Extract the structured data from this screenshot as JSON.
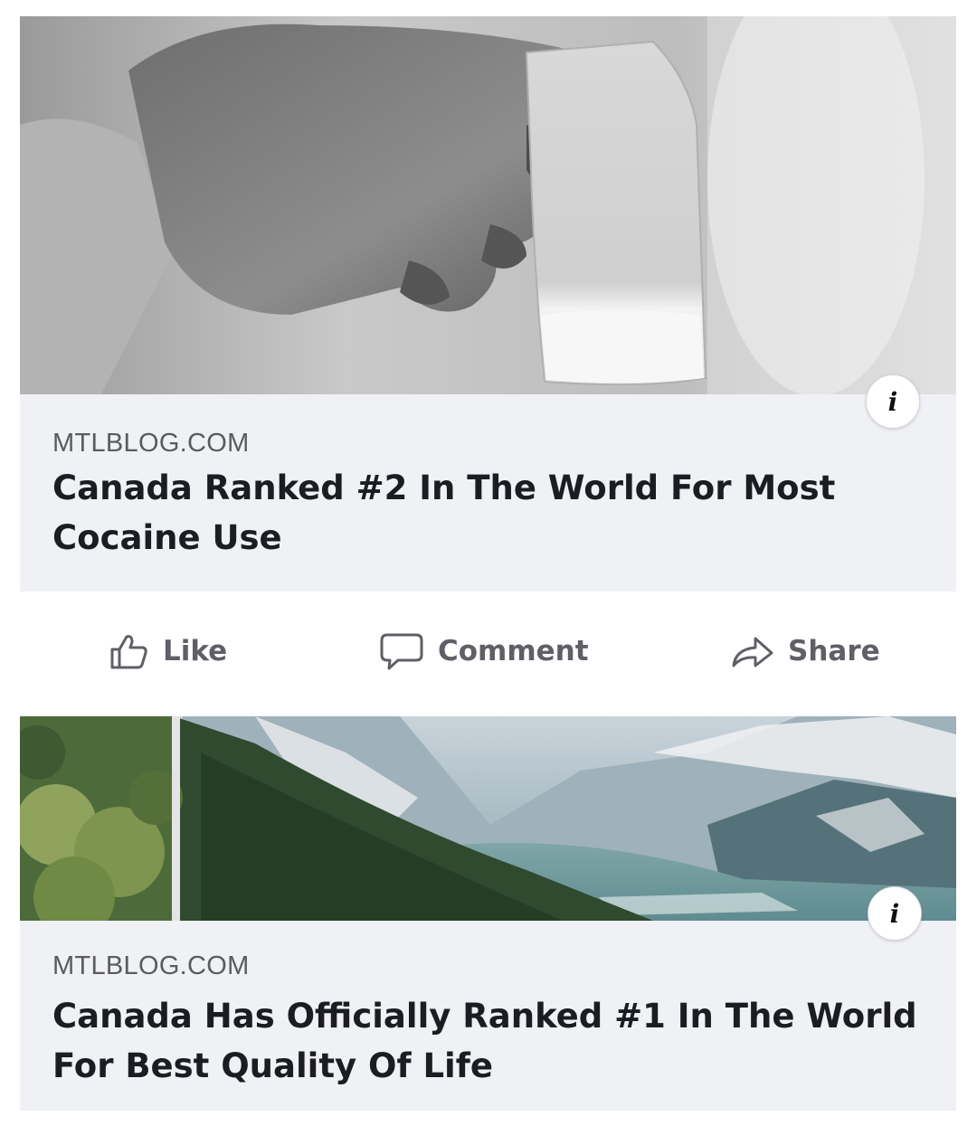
{
  "posts": [
    {
      "source": "MTLBLOG.COM",
      "headline": "Canada Ranked #2 In The World For Most Cocaine Use",
      "image_desc": "hand-holding-bag-photo"
    },
    {
      "source": "MTLBLOG.COM",
      "headline": "Canada Has Officially Ranked #1 In The World For Best Quality Of Life",
      "image_desc": "mountain-forest-photo"
    }
  ],
  "actions": {
    "like": "Like",
    "comment": "Comment",
    "share": "Share"
  },
  "info_icon": "i",
  "colors": {
    "card_bg": "#f0f1f5",
    "headline": "#1c1d22",
    "source": "#5a5b60",
    "action": "#5f6066"
  }
}
